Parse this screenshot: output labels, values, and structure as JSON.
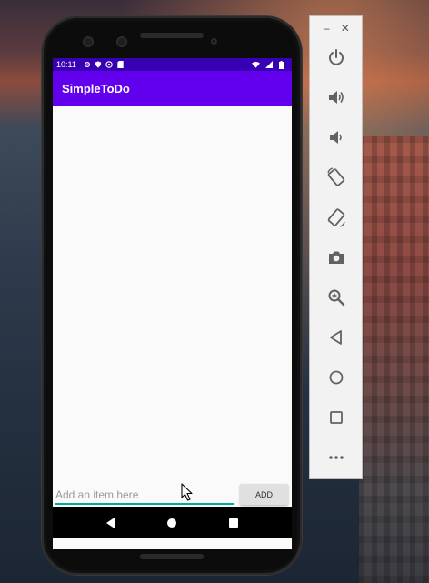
{
  "status_bar": {
    "time": "10:11",
    "icons": [
      "gear-icon",
      "shield-icon",
      "at-icon",
      "sd-card-icon"
    ],
    "right_icons": [
      "wifi-icon",
      "signal-icon",
      "battery-icon"
    ]
  },
  "app": {
    "title": "SimpleToDo",
    "items": []
  },
  "input": {
    "placeholder": "Add an item here",
    "value": ""
  },
  "add_button": {
    "label": "ADD"
  },
  "nav_bar": {
    "buttons": [
      "back-icon",
      "home-icon",
      "recents-icon"
    ]
  },
  "emulator_toolbar": {
    "window_buttons": [
      "minimize-icon",
      "close-icon"
    ],
    "minimize_symbol": "–",
    "close_symbol": "✕",
    "tools": [
      "power-icon",
      "volume-up-icon",
      "volume-down-icon",
      "rotate-left-icon",
      "rotate-right-icon",
      "camera-icon",
      "zoom-icon",
      "back-icon",
      "home-icon",
      "overview-icon",
      "more-icon"
    ]
  },
  "colors": {
    "status_bar": "#3700b3",
    "app_bar": "#6200ee",
    "accent": "#03a9a0",
    "button": "#e0e0e0"
  }
}
